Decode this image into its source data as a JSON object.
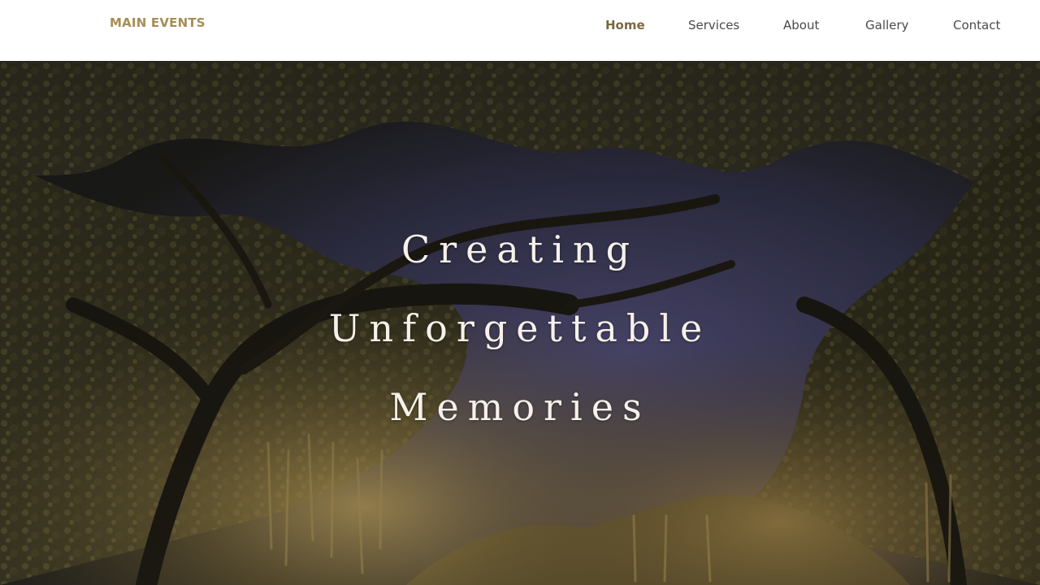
{
  "header": {
    "brand": "MAIN EVENTS",
    "nav": [
      {
        "label": "Home",
        "active": true
      },
      {
        "label": "Services",
        "active": false
      },
      {
        "label": "About",
        "active": false
      },
      {
        "label": "Gallery",
        "active": false
      },
      {
        "label": "Contact",
        "active": false
      }
    ]
  },
  "hero": {
    "heading_lines": [
      "Creating",
      "Unforgettable",
      "Memories"
    ],
    "background_image": "night-oak-trees-photo"
  },
  "colors": {
    "brand": "#a78d55",
    "nav_text": "#4a4a4a",
    "nav_active": "#7a6a40",
    "heading": "#f6f1ea",
    "sky": "#56507a"
  }
}
